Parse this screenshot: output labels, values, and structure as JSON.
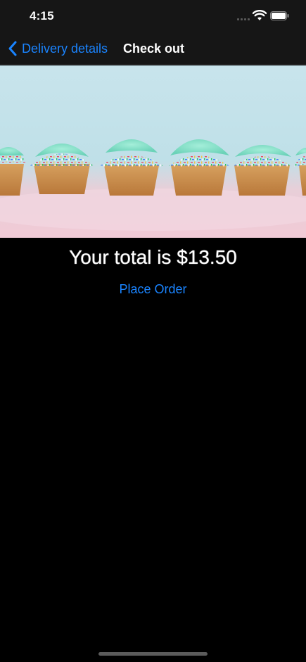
{
  "status_bar": {
    "time": "4:15",
    "icons": [
      "cellular-signal-icon",
      "wifi-icon",
      "battery-icon"
    ]
  },
  "nav": {
    "back_label": "Delivery details",
    "title": "Check out",
    "accent_color": "#1a84ff"
  },
  "hero_image": {
    "subject": "cupcakes with mint frosting and rainbow sprinkles"
  },
  "checkout": {
    "total_text": "Your total is $13.50",
    "place_order_label": "Place Order"
  }
}
